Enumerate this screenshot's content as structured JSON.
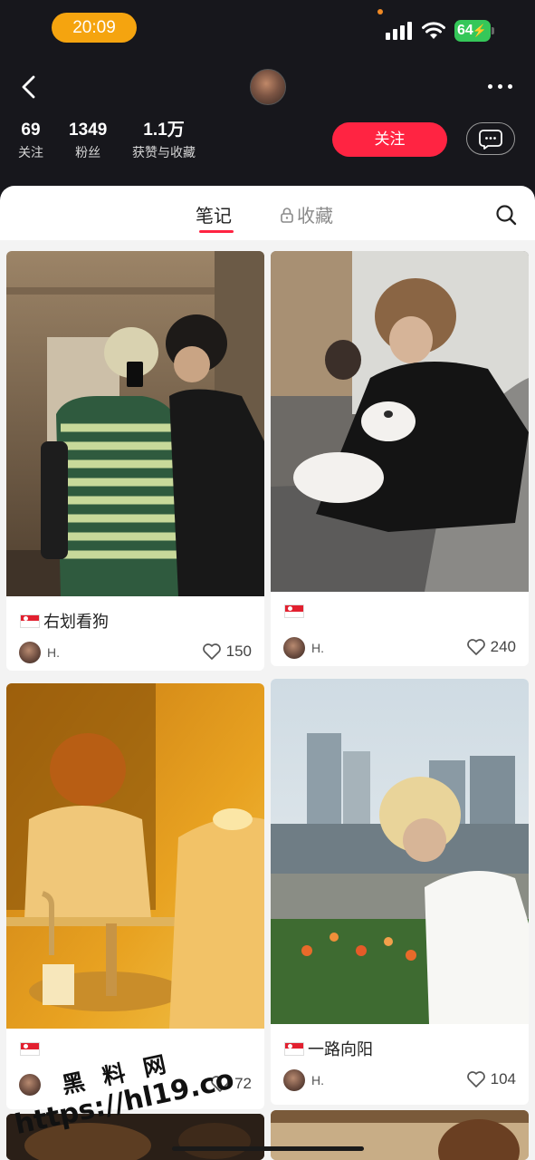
{
  "status_bar": {
    "time": "20:09",
    "battery": "64"
  },
  "profile": {
    "stats": [
      {
        "value": "69",
        "label": "关注"
      },
      {
        "value": "1349",
        "label": "粉丝"
      },
      {
        "value": "1.1万",
        "label": "获赞与收藏"
      }
    ],
    "follow_label": "关注"
  },
  "tabs": {
    "notes": "笔记",
    "collections": "收藏"
  },
  "feed": [
    {
      "title": "右划看狗",
      "author": "H.",
      "likes": "150"
    },
    {
      "title": "",
      "author": "H.",
      "likes": "240"
    },
    {
      "title": "",
      "author": "",
      "likes": "72"
    },
    {
      "title": "一路向阳",
      "author": "H.",
      "likes": "104"
    }
  ],
  "watermark": {
    "line1": "黑 料 网",
    "line2": "https://hl19.co"
  },
  "colors": {
    "accent": "#ff2442",
    "header_bg": "#17171c",
    "time_pill": "#f5a40f",
    "battery": "#35c759"
  },
  "icons": [
    "back-arrow-icon",
    "more-dots-icon",
    "chat-bubble-icon",
    "lock-icon",
    "search-icon",
    "heart-icon",
    "singapore-flag-icon",
    "wifi-icon",
    "signal-icon"
  ]
}
